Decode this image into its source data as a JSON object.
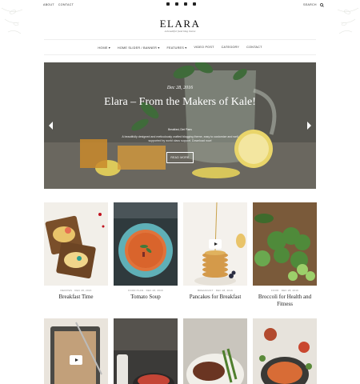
{
  "topbar": {
    "links": [
      "ABOUT",
      "CONTACT"
    ],
    "social_icons": [
      "facebook-icon",
      "twitter-icon",
      "youtube-icon",
      "instagram-icon"
    ],
    "search_label": "SEARCH"
  },
  "header": {
    "logo": "ELARA",
    "tagline": "A beautiful food blog theme"
  },
  "nav": {
    "items": [
      "HOME ▾",
      "HOME SLIDER / BANNER ▾",
      "FEATURES ▾",
      "VIDEO POST",
      "CATEGORY",
      "CONTACT"
    ]
  },
  "slider": {
    "date": "Dec 28, 2016",
    "title": "Elara – From the Makers of Kale!",
    "category": "Breakfast, Diet Plans",
    "description": "A beautifully designed and meticulously crafted blogging theme, easy to customize and well supported by world class support. Download now!",
    "read_more": "READ MORE",
    "accent": "#ffffff"
  },
  "posts": [
    {
      "meta": "RECIPES · DEC 28, 2016",
      "title": "Breakfast Time"
    },
    {
      "meta": "FOOD PLAN · DEC 28, 2016",
      "title": "Tomato Soup"
    },
    {
      "meta": "BREAKFAST · DEC 28, 2016",
      "title": "Pancakes for Breakfast"
    },
    {
      "meta": "FOOD · DEC 28, 2016",
      "title": "Broccoli for Health and Fitness"
    }
  ]
}
